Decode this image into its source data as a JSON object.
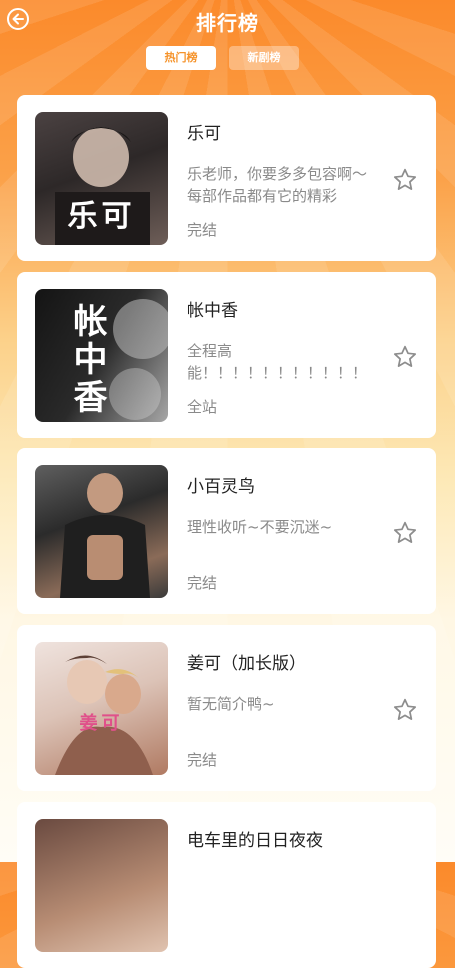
{
  "header": {
    "title": "排行榜",
    "back_icon": "back-arrow-icon"
  },
  "tabs": [
    {
      "label": "热门榜",
      "active": true
    },
    {
      "label": "新剧榜",
      "active": false
    }
  ],
  "list": [
    {
      "name": "乐可",
      "desc": "乐老师，你要多多包容啊～每部作品都有它的精彩",
      "status": "完结",
      "cover_text": "乐可",
      "cover_colors": [
        "#3a3535",
        "#6d5c56"
      ]
    },
    {
      "name": "帐中香",
      "desc": "全程高 能！！！！！！！！！！！",
      "status": "全站",
      "cover_text": "帐中香",
      "cover_colors": [
        "#1b1b1b",
        "#8a8a8a"
      ]
    },
    {
      "name": "小百灵鸟",
      "desc": "理性收听~不要沉迷~",
      "status": "完结",
      "cover_text": "",
      "cover_colors": [
        "#2b2b2b",
        "#9c7f6d"
      ]
    },
    {
      "name": "姜可（加长版）",
      "desc": "暂无简介鸭~",
      "status": "完结",
      "cover_text": "姜可",
      "cover_colors": [
        "#e8d6d0",
        "#c98d6f"
      ]
    },
    {
      "name": "电车里的日日夜夜",
      "desc": "",
      "status": "",
      "cover_text": "",
      "cover_colors": [
        "#5a4039",
        "#c9a38a"
      ]
    }
  ]
}
